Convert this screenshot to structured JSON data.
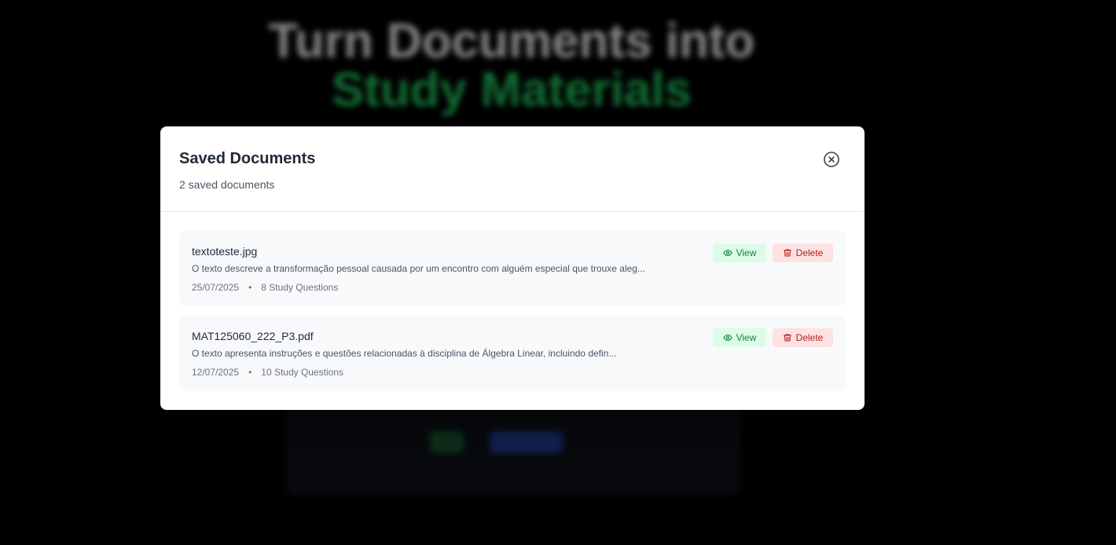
{
  "background": {
    "hero_line1": "Turn Documents into",
    "hero_line2": "Study Materials"
  },
  "modal": {
    "title": "Saved Documents",
    "subtitle": "2 saved documents",
    "close_icon": "close-circle-icon",
    "documents": [
      {
        "name": "textoteste.jpg",
        "summary": "O texto descreve a transformação pessoal causada por um encontro com alguém especial que trouxe aleg...",
        "date": "25/07/2025",
        "questions": "8 Study Questions"
      },
      {
        "name": "MAT125060_222_P3.pdf",
        "summary": "O texto apresenta instruções e questões relacionadas à disciplina de Álgebra Linear, incluindo defin...",
        "date": "12/07/2025",
        "questions": "10 Study Questions"
      }
    ],
    "view_label": "View",
    "delete_label": "Delete",
    "view_icon": "eye-icon",
    "delete_icon": "trash-icon",
    "meta_separator": "•"
  },
  "colors": {
    "accent_green": "#22c55e",
    "view_bg": "#dcfce7",
    "view_text": "#15803d",
    "delete_bg": "#fee2e2",
    "delete_text": "#b91c1c"
  }
}
